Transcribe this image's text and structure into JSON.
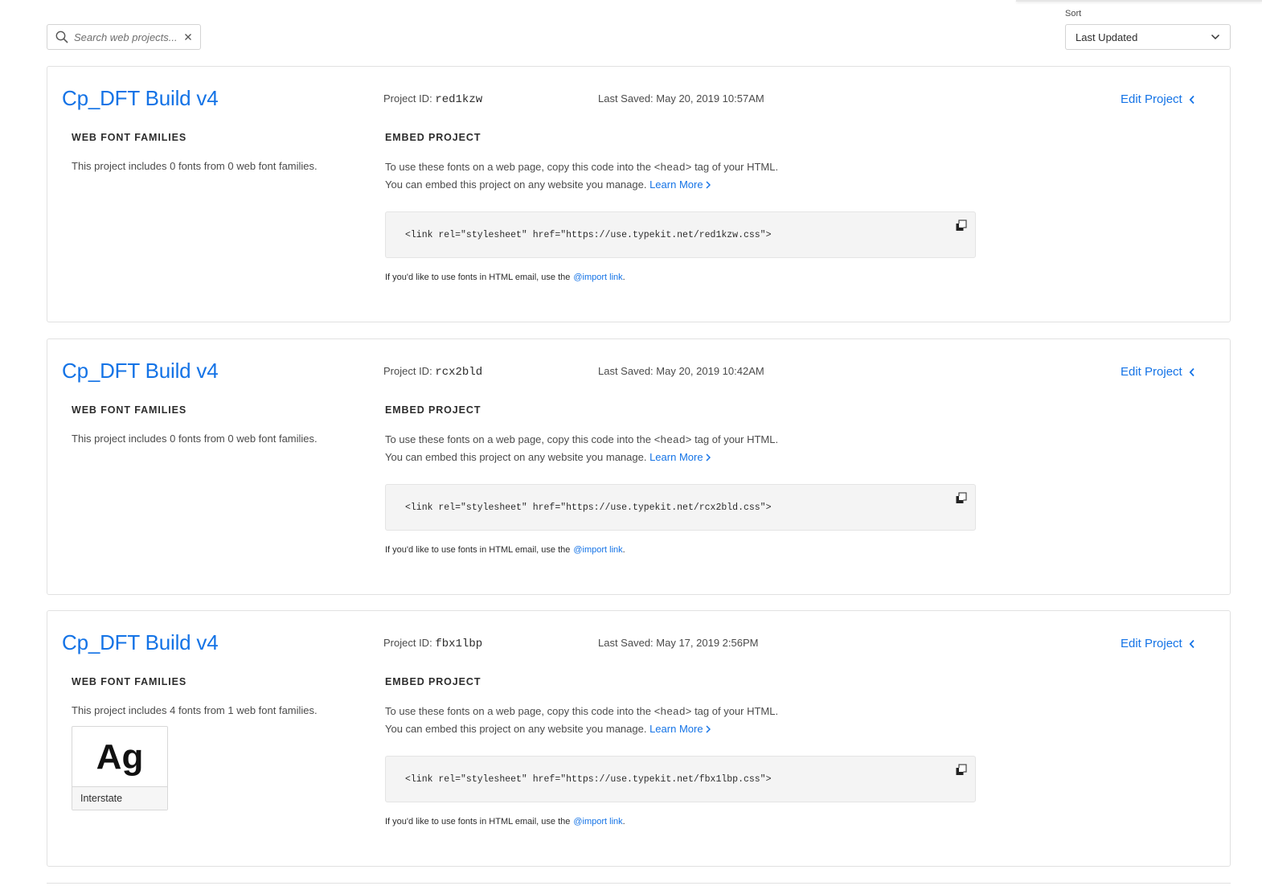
{
  "search": {
    "placeholder": "Search web projects...",
    "value": ""
  },
  "sort": {
    "label": "Sort",
    "selected": "Last Updated"
  },
  "labels": {
    "project_id": "Project ID:",
    "last_saved_prefix": "Last Saved:",
    "edit_project": "Edit Project",
    "web_font_families": "WEB FONT FAMILIES",
    "embed_project": "EMBED PROJECT",
    "embed_line1_pre": "To use these fonts on a web page, copy this code into the",
    "embed_line1_code": "<head>",
    "embed_line1_post": "tag of your HTML.",
    "embed_line2": "You can embed this project on any website you manage.",
    "learn_more": "Learn More",
    "email_note": "If you'd like to use fonts in HTML email, use the",
    "import_link": "@import link",
    "import_period": "."
  },
  "projects": [
    {
      "title": "Cp_DFT Build v4",
      "id": "red1kzw",
      "last_saved": "May 20, 2019 10:57AM",
      "fonts_desc": "This project includes 0 fonts from 0 web font families.",
      "embed_code": "<link rel=\"stylesheet\" href=\"https://use.typekit.net/red1kzw.css\">",
      "fonts": []
    },
    {
      "title": "Cp_DFT Build v4",
      "id": "rcx2bld",
      "last_saved": "May 20, 2019 10:42AM",
      "fonts_desc": "This project includes 0 fonts from 0 web font families.",
      "embed_code": "<link rel=\"stylesheet\" href=\"https://use.typekit.net/rcx2bld.css\">",
      "fonts": []
    },
    {
      "title": "Cp_DFT Build v4",
      "id": "fbx1lbp",
      "last_saved": "May 17, 2019 2:56PM",
      "fonts_desc": "This project includes 4 fonts from 1 web font families.",
      "embed_code": "<link rel=\"stylesheet\" href=\"https://use.typekit.net/fbx1lbp.css\">",
      "fonts": [
        {
          "sample": "Ag",
          "name": "Interstate"
        }
      ]
    }
  ],
  "colors": {
    "accent": "#1473e6",
    "text": "#2c2c2c",
    "muted": "#4b4b4b",
    "code_bg": "#f4f4f4",
    "border": "#e1e1e1"
  },
  "icons": {
    "search": "search-icon",
    "clear": "close-icon",
    "sort_chevron": "chevron-down-icon",
    "edit_chevron": "chevron-left-icon",
    "learn_more": "chevron-right-icon",
    "copy": "copy-icon"
  }
}
